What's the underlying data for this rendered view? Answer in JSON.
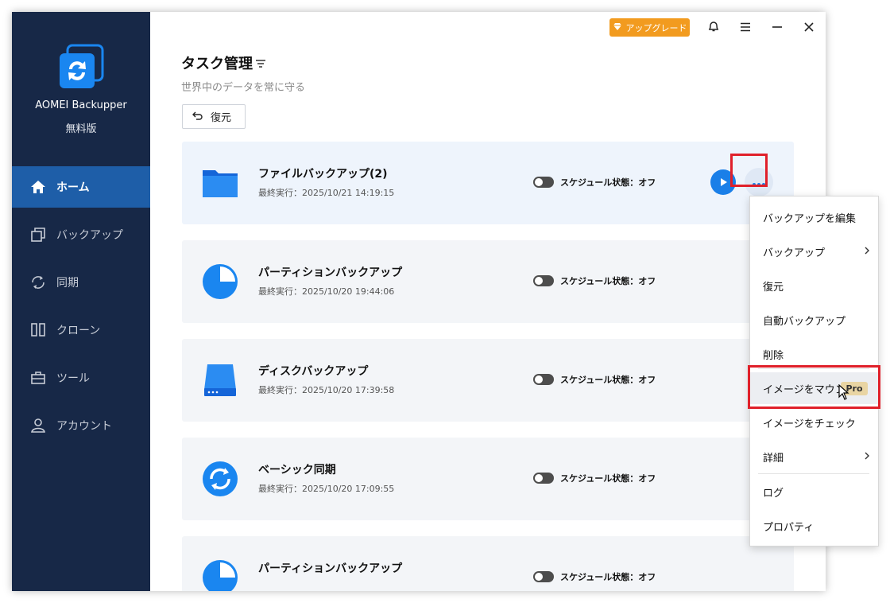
{
  "app": {
    "name": "AOMEI Backupper",
    "edition": "無料版"
  },
  "topbar": {
    "upgrade_label": "アップグレード"
  },
  "sidebar": {
    "items": [
      {
        "label": "ホーム",
        "icon": "home-icon",
        "active": true
      },
      {
        "label": "バックアップ",
        "icon": "backup-icon",
        "active": false
      },
      {
        "label": "同期",
        "icon": "sync-icon",
        "active": false
      },
      {
        "label": "クローン",
        "icon": "clone-icon",
        "active": false
      },
      {
        "label": "ツール",
        "icon": "tools-icon",
        "active": false
      },
      {
        "label": "アカウント",
        "icon": "account-icon",
        "active": false
      }
    ]
  },
  "main": {
    "title": "タスク管理",
    "subtitle": "世界中のデータを常に守る",
    "restore_label": "復元"
  },
  "tasks": [
    {
      "name": "ファイルバックアップ(2)",
      "last_run": "最終実行：2025/10/21 14:19:15",
      "schedule": "スケジュール状態：オフ",
      "icon": "folder-icon"
    },
    {
      "name": "パーティションバックアップ",
      "last_run": "最終実行：2025/10/20 19:44:06",
      "schedule": "スケジュール状態：オフ",
      "icon": "partition-icon"
    },
    {
      "name": "ディスクバックアップ",
      "last_run": "最終実行：2025/10/20 17:39:58",
      "schedule": "スケジュール状態：オフ",
      "icon": "disk-icon"
    },
    {
      "name": "ベーシック同期",
      "last_run": "最終実行：2025/10/20 17:09:55",
      "schedule": "スケジュール状態：オフ",
      "icon": "sync-icon"
    },
    {
      "name": "パーティションバックアップ",
      "last_run": "",
      "schedule": "スケジュール状態：オフ",
      "icon": "partition-icon"
    }
  ],
  "menu": {
    "items": [
      {
        "label": "バックアップを編集",
        "submenu": false
      },
      {
        "label": "バックアップ",
        "submenu": true
      },
      {
        "label": "復元",
        "submenu": false
      },
      {
        "label": "自動バックアップ",
        "submenu": false
      },
      {
        "label": "削除",
        "submenu": false
      },
      {
        "label": "イメージをマウント",
        "submenu": false,
        "badge": "Pro",
        "hovered": true
      },
      {
        "label": "イメージをチェック",
        "submenu": false
      },
      {
        "label": "詳細",
        "submenu": true
      },
      {
        "label": "ログ",
        "submenu": false
      },
      {
        "label": "プロパティ",
        "submenu": false
      }
    ]
  },
  "colors": {
    "sidebar": "#172847",
    "accent": "#1a7fe8",
    "active_nav": "#1e5ea8",
    "upgrade": "#f29b1f",
    "highlight": "#e0202a"
  }
}
